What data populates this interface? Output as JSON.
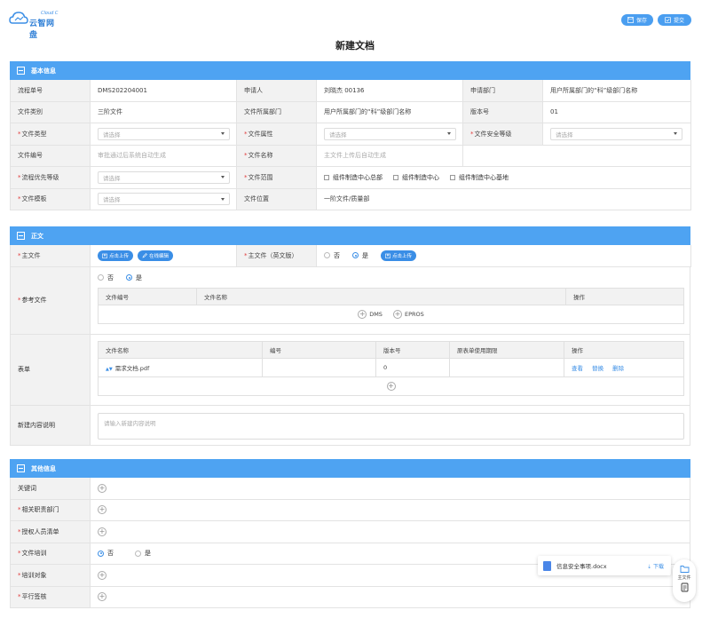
{
  "brand": {
    "en": "Cloud C",
    "cn": "云智网盘"
  },
  "toolbar": {
    "save_label": "保存",
    "submit_label": "提交"
  },
  "page_title": "新建文档",
  "basic": {
    "title": "基本信息",
    "process_no_label": "流程单号",
    "process_no": "DMS202204001",
    "applicant_label": "申请人",
    "applicant": "刘晓杰  00136",
    "apply_dept_label": "申请部门",
    "apply_dept": "用户所属部门的“科”级部门名称",
    "doc_category_label": "文件类别",
    "doc_category": "三阶文件",
    "doc_dept_label": "文件所属部门",
    "doc_dept": "用户所属部门的“科”级部门名称",
    "version_label": "版本号",
    "version": "01",
    "doc_type_label": "文件类型",
    "doc_attr_label": "文件属性",
    "doc_security_label": "文件安全等级",
    "select_placeholder": "请选择",
    "doc_no_label": "文件编号",
    "doc_no_hint": "审批通过后系统自动生成",
    "doc_name_label": "文件名称",
    "doc_name_hint": "主文件上传后自动生成",
    "priority_label": "流程优先等级",
    "scope_label": "文件范围",
    "scope_options": [
      "组件制造中心总部",
      "组件制造中心",
      "组件制造中心基地"
    ],
    "template_label": "文件模板",
    "location_label": "文件位置",
    "location": "一阶文件/质量部"
  },
  "body": {
    "title": "正文",
    "main_file_label": "主文件",
    "upload_label": "点击上传",
    "online_edit_label": "在线编辑",
    "main_file_en_label": "主文件（英文版）",
    "no_label": "否",
    "yes_label": "是",
    "ref_label": "参考文件",
    "ref_columns": [
      "文件编号",
      "文件名称",
      "操作"
    ],
    "ref_add_dms": "DMS",
    "ref_add_epros": "EPROS",
    "form_label": "表单",
    "form_columns": [
      "文件名称",
      "编号",
      "版本号",
      "原表单使用期限",
      "操作"
    ],
    "form_row": {
      "name": "需求文档.pdf",
      "no": "",
      "version": "0",
      "period": ""
    },
    "form_ops": [
      "查看",
      "替换",
      "删除"
    ],
    "desc_label": "新建内容说明",
    "desc_placeholder": "请输入新建内容说明"
  },
  "other": {
    "title": "其他信息",
    "keywords_label": "关键词",
    "related_dept_label": "相关职责部门",
    "authorized_label": "授权人员清单",
    "training_label": "文件培训",
    "training_no": "否",
    "training_yes": "是",
    "training_target_label": "培训对象",
    "parallel_sign_label": "平行签核"
  },
  "float_file": {
    "name": "信息安全事项.docx",
    "download_label": "下载"
  },
  "side_panel": {
    "main_file_label": "主文件"
  }
}
